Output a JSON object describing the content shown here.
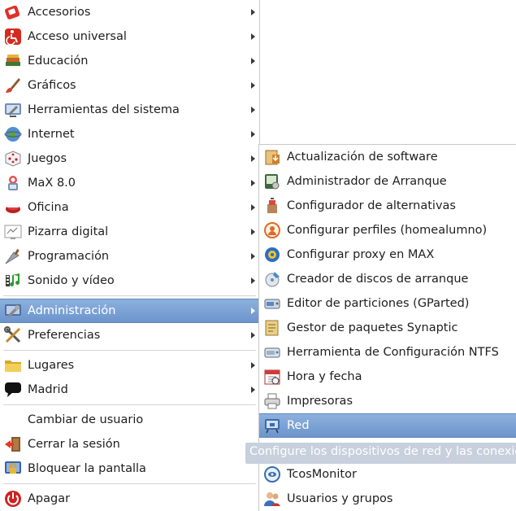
{
  "main_menu": {
    "items": [
      {
        "label": "Accesorios",
        "icon": "accessories-icon"
      },
      {
        "label": "Acceso universal",
        "icon": "accessibility-icon"
      },
      {
        "label": "Educación",
        "icon": "education-books-icon"
      },
      {
        "label": "Gráficos",
        "icon": "graphics-brush-icon"
      },
      {
        "label": "Herramientas del sistema",
        "icon": "system-tools-icon"
      },
      {
        "label": "Internet",
        "icon": "globe-icon"
      },
      {
        "label": "Juegos",
        "icon": "dice-icon"
      },
      {
        "label": "MaX 8.0",
        "icon": "max-logo-icon"
      },
      {
        "label": "Oficina",
        "icon": "office-icon"
      },
      {
        "label": "Pizarra digital",
        "icon": "whiteboard-icon"
      },
      {
        "label": "Programación",
        "icon": "programming-trowel-icon"
      },
      {
        "label": "Sonido y vídeo",
        "icon": "multimedia-icon"
      },
      {
        "label": "Administración",
        "icon": "administration-icon"
      },
      {
        "label": "Preferencias",
        "icon": "preferences-tools-icon"
      },
      {
        "label": "Lugares",
        "icon": "folder-icon"
      },
      {
        "label": "Madrid",
        "icon": "speech-bubble-icon"
      },
      {
        "label": "Cambiar de usuario",
        "icon": ""
      },
      {
        "label": "Cerrar la sesión",
        "icon": "logout-icon"
      },
      {
        "label": "Bloquear la pantalla",
        "icon": "lock-screen-icon"
      },
      {
        "label": "Apagar",
        "icon": "power-icon"
      }
    ]
  },
  "sub_menu": {
    "items": [
      {
        "label": "Actualización de software",
        "icon": "software-update-icon"
      },
      {
        "label": "Administrador de Arranque",
        "icon": "boot-manager-icon"
      },
      {
        "label": "Configurador de alternativas",
        "icon": "alternatives-icon"
      },
      {
        "label": "Configurar perfiles (homealumno)",
        "icon": "profiles-icon"
      },
      {
        "label": "Configurar proxy en MAX",
        "icon": "proxy-icon"
      },
      {
        "label": "Creador de discos de arranque",
        "icon": "boot-disk-icon"
      },
      {
        "label": "Editor de particiones (GParted)",
        "icon": "gparted-icon"
      },
      {
        "label": "Gestor de paquetes Synaptic",
        "icon": "synaptic-icon"
      },
      {
        "label": "Herramienta de Configuración NTFS",
        "icon": "ntfs-disk-icon"
      },
      {
        "label": "Hora y fecha",
        "icon": "calendar-icon"
      },
      {
        "label": "Impresoras",
        "icon": "printer-icon"
      },
      {
        "label": "Red",
        "icon": "network-icon"
      },
      {
        "label": "TcosMonitor",
        "icon": "tcos-monitor-icon"
      },
      {
        "label": "Usuarios y grupos",
        "icon": "users-icon"
      }
    ]
  },
  "tooltip": {
    "text": "Configure los dispositivos de red y las conexiones"
  },
  "colors": {
    "highlight": "#7aa1d5",
    "tooltip_bg": "#c7d0dc"
  }
}
